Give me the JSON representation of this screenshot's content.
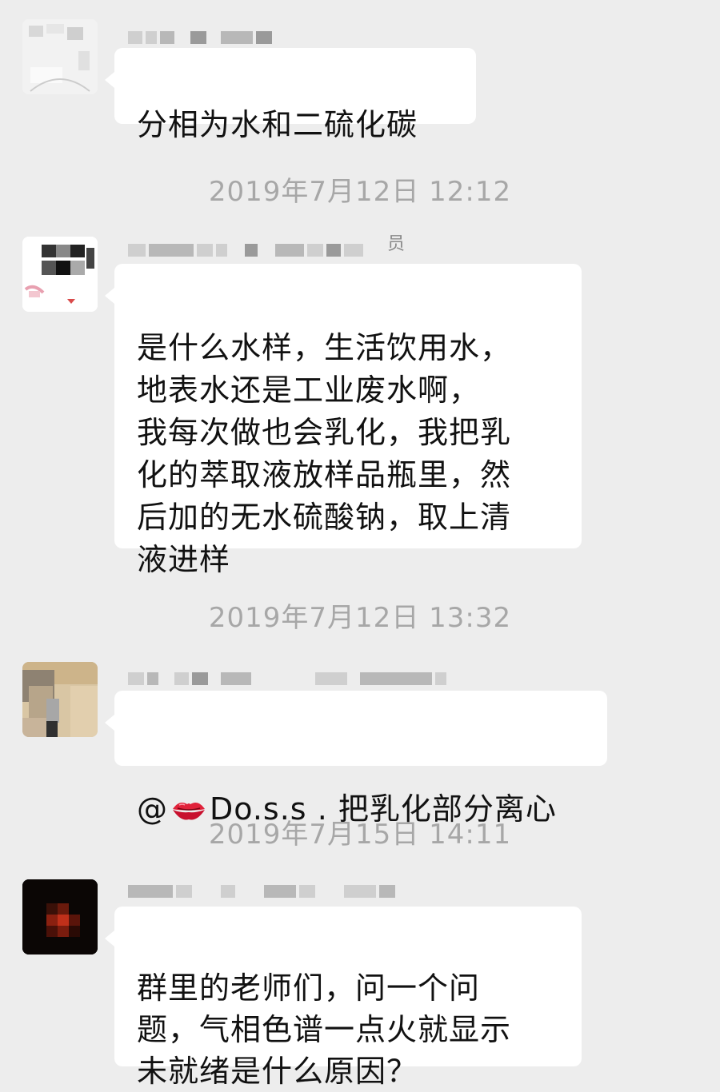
{
  "messages": [
    {
      "text": "分相为水和二硫化碳"
    },
    {
      "sender_suffix": "员",
      "text": "是什么水样，生活饮用水，\n地表水还是工业废水啊，\n我每次做也会乳化，我把乳\n化的萃取液放样品瓶里，然\n后加的无水硫酸钠，取上清\n液进样"
    },
    {
      "mention_prefix": "@",
      "mention_name": "Do.s.s",
      "text": " . 把乳化部分离心"
    },
    {
      "text": "群里的老师们，问一个问\n题，气相色谱一点火就显示\n未就绪是什么原因？"
    }
  ],
  "timestamps": [
    "2019年7月12日 12:12",
    "2019年7月12日 13:32",
    "2019年7月15日 14:11"
  ],
  "icons": {
    "mention_emoji": "kiss-lips-icon"
  },
  "colors": {
    "background": "#ededed",
    "bubble": "#ffffff",
    "timestamp": "#a7a7a7"
  }
}
